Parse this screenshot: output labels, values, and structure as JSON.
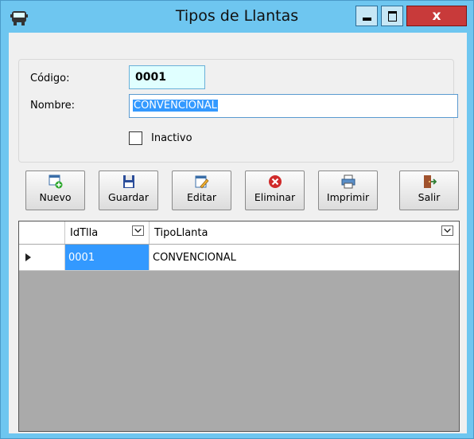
{
  "window": {
    "title": "Tipos de Llantas",
    "close_glyph": "x",
    "app_icon": "bus-icon",
    "colors": {
      "frame": "#6ec6f0",
      "close": "#c83a3a",
      "selection": "#3399ff",
      "code_bg": "#e0ffff"
    }
  },
  "form": {
    "codigo_label": "Código:",
    "codigo_value": "0001",
    "nombre_label": "Nombre:",
    "nombre_value": "CONVENCIONAL",
    "inactivo_label": "Inactivo",
    "inactivo_checked": false
  },
  "toolbar": {
    "nuevo": "Nuevo",
    "guardar": "Guardar",
    "editar": "Editar",
    "eliminar": "Eliminar",
    "imprimir": "Imprimir",
    "salir": "Salir"
  },
  "grid": {
    "columns": [
      "IdTlla",
      "TipoLlanta"
    ],
    "rows": [
      [
        "0001",
        "CONVENCIONAL"
      ]
    ],
    "selected_row": 0
  }
}
